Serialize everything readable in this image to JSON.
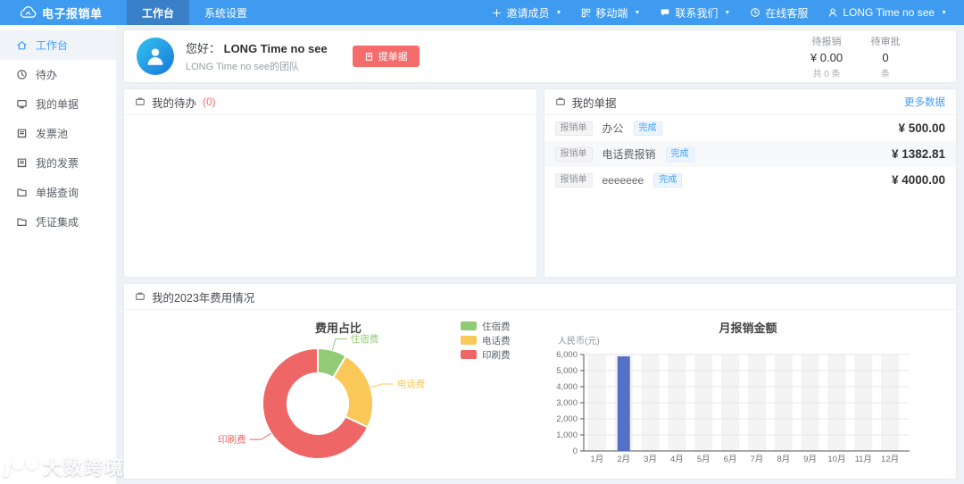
{
  "navbar": {
    "logo_text": "电子报销单",
    "tabs": [
      {
        "key": "workbench",
        "label": "工作台",
        "active": true
      },
      {
        "key": "system-settings",
        "label": "系统设置",
        "active": false
      }
    ],
    "menu": [
      {
        "key": "invite-members",
        "label": "邀请成员",
        "icon": "plus-icon",
        "caret": true
      },
      {
        "key": "mobile",
        "label": "移动端",
        "icon": "qrcode-icon",
        "caret": true
      },
      {
        "key": "contact-us",
        "label": "联系我们",
        "icon": "chat-icon",
        "caret": true
      },
      {
        "key": "online-service",
        "label": "在线客服",
        "icon": "headset-icon",
        "caret": false
      },
      {
        "key": "user",
        "label": "LONG Time no see",
        "icon": "user-icon",
        "caret": true
      }
    ]
  },
  "sidebar": {
    "items": [
      {
        "key": "workbench",
        "label": "工作台",
        "icon": "home-icon",
        "active": true
      },
      {
        "key": "todo",
        "label": "待办",
        "icon": "clock-icon",
        "active": false
      },
      {
        "key": "my-documents",
        "label": "我的单据",
        "icon": "board-icon",
        "active": false
      },
      {
        "key": "invoice-pool",
        "label": "发票池",
        "icon": "invoice-icon",
        "active": false
      },
      {
        "key": "my-invoices",
        "label": "我的发票",
        "icon": "invoice-icon",
        "active": false
      },
      {
        "key": "document-query",
        "label": "单据查询",
        "icon": "folder-icon",
        "active": false
      },
      {
        "key": "voucher-integration",
        "label": "凭证集成",
        "icon": "folder-icon",
        "active": false
      }
    ]
  },
  "header_card": {
    "greeting_prefix": "您好： ",
    "username": "LONG Time no see",
    "team": "LONG Time no see的团队",
    "submit_button": "提单据",
    "stats": [
      {
        "label": "待报销",
        "value": "¥ 0.00",
        "sub": "共 0 条"
      },
      {
        "label": "待审批",
        "value": "0",
        "sub": "条"
      }
    ]
  },
  "todo_panel": {
    "title": "我的待办",
    "count": "(0)"
  },
  "documents_panel": {
    "title": "我的单据",
    "more_link": "更多数据",
    "rows": [
      {
        "type": "报销单",
        "name": "办公",
        "status": "完成",
        "amount": "¥ 500.00"
      },
      {
        "type": "报销单",
        "name": "电话费报销",
        "status": "完成",
        "amount": "¥ 1382.81"
      },
      {
        "type": "报销单",
        "name": "eeeeeee",
        "status": "完成",
        "amount": "¥ 4000.00"
      }
    ]
  },
  "expense_panel": {
    "title": "我的2023年费用情况"
  },
  "chart_data": [
    {
      "type": "pie",
      "title": "费用占比",
      "donut": true,
      "labels": [
        "住宿费",
        "电话费",
        "印刷费"
      ],
      "values": [
        500,
        1382.81,
        4000
      ],
      "colors": [
        "#91cc75",
        "#fac858",
        "#ee6666"
      ],
      "legend_position": "right",
      "start_angle_deg": -90,
      "clockwise": true
    },
    {
      "type": "bar",
      "title": "月报销金额",
      "ylabel": "人民币(元)",
      "categories": [
        "1月",
        "2月",
        "3月",
        "4月",
        "5月",
        "6月",
        "7月",
        "8月",
        "9月",
        "10月",
        "11月",
        "12月"
      ],
      "values": [
        0,
        5882.81,
        0,
        0,
        0,
        0,
        0,
        0,
        0,
        0,
        0,
        0
      ],
      "ylim": [
        0,
        6000
      ],
      "ytick_step": 1000,
      "bar_color": "#5470c6",
      "band_color": "#f4f4f4",
      "grid": true
    }
  ],
  "watermark": {
    "brand": "大数跨境"
  }
}
